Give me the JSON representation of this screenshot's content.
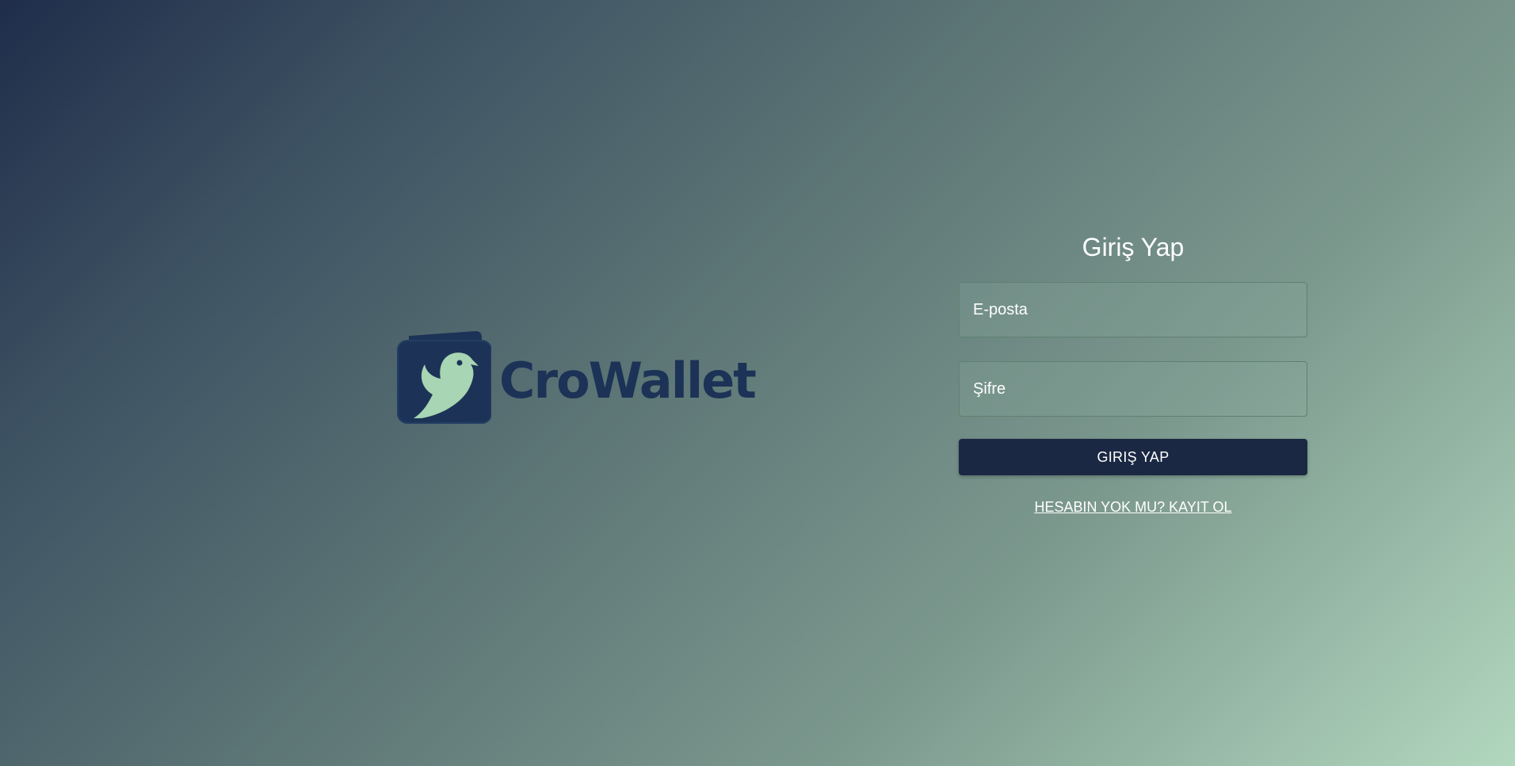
{
  "colors": {
    "brand_navy": "#1c3357",
    "brand_mint": "#a8d5b3",
    "button_bg": "#1b2843",
    "text_white": "#ffffff"
  },
  "logo": {
    "icon": "crow-wallet-logo-icon",
    "wordmark": "CroWallet"
  },
  "login": {
    "title": "Giriş Yap",
    "email_placeholder": "E-posta",
    "email_value": "",
    "password_placeholder": "Şifre",
    "password_value": "",
    "submit_label": "GIRIŞ YAP",
    "register_link": "HESABIN YOK MU? KAYIT OL"
  }
}
